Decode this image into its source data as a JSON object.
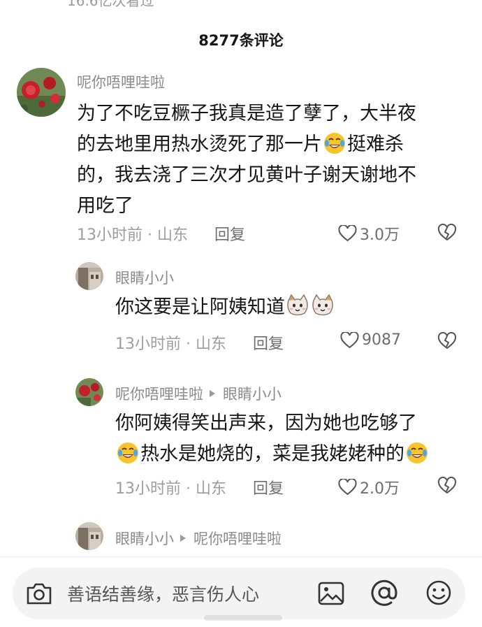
{
  "top_stub": {
    "views_text": "16.6亿次看过"
  },
  "header": {
    "title": "8277条评论"
  },
  "comments": [
    {
      "username": "呢你唔哩哇啦",
      "lines": [
        "为了不吃豆橛子我真是造了孽了，大半夜",
        "的去地里用热水烫死了那一片",
        "挺难杀",
        "的，我去浇了三次才见黄叶子谢天谢地不",
        "用吃了"
      ],
      "time_location": "13小时前 · 山东",
      "reply_label": "回复",
      "likes": "3.0万"
    },
    {
      "username": "眼睛小小",
      "lines": [
        "你这要是让阿姨知道"
      ],
      "time_location": "13小时前 · 山东",
      "reply_label": "回复",
      "likes": "9087"
    },
    {
      "username": "呢你唔哩哇啦",
      "reply_to": "眼睛小小",
      "lines": [
        "你阿姨得笑出声来，因为她也吃够了",
        "热水是她烧的，菜是我姥姥种的"
      ],
      "time_location": "13小时前 · 山东",
      "reply_label": "回复",
      "likes": "2.0万"
    },
    {
      "username": "眼睛小小",
      "reply_to": "呢你唔哩哇啦"
    }
  ],
  "input": {
    "placeholder": "善语结善缘，恶言伤人心"
  },
  "icons": [
    "camera-icon",
    "image-icon",
    "at-icon",
    "emoji-icon",
    "heart-icon",
    "broken-heart-icon",
    "laugh-cry-emoji",
    "cat-face-emoji"
  ],
  "colors": {
    "text": "#161616",
    "secondary": "#8b8b8b",
    "meta": "#9d9d9d",
    "bar_bg": "#f3f3f3"
  }
}
